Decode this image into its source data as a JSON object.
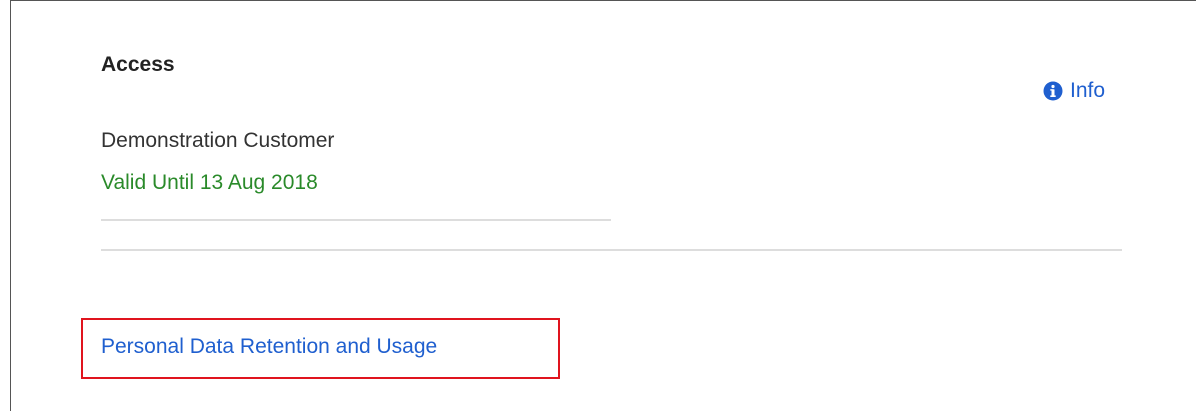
{
  "access": {
    "title": "Access",
    "info_label": "Info",
    "info_icon": "info-circle-icon",
    "customer_name": "Demonstration Customer",
    "valid_until": "Valid Until 13 Aug 2018"
  },
  "links": {
    "personal_data": "Personal Data Retention and Usage"
  },
  "colors": {
    "link": "#1f5fcf",
    "valid": "#2a8a2a",
    "highlight": "#e0141e",
    "divider": "#dddddd"
  }
}
